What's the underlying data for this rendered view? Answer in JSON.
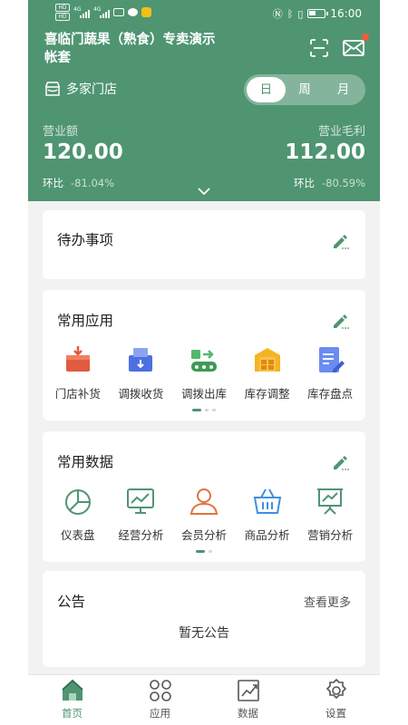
{
  "status_bar": {
    "time": "16:00",
    "left_indicators": [
      "HD",
      "HD",
      "4G",
      "4G"
    ],
    "icons": [
      "signal-icon",
      "signal-icon",
      "mail-icon",
      "chat-icon",
      "shield-icon",
      "nfc-icon",
      "bluetooth-icon",
      "vibrate-icon",
      "battery-icon"
    ]
  },
  "header": {
    "store_title": "喜临门蔬果（熟食）专卖演示帐套",
    "store_selector_label": "多家门店",
    "period_options": [
      "日",
      "周",
      "月"
    ],
    "active_period": "日",
    "revenue": {
      "label": "营业额",
      "value": "120.00",
      "change_label": "环比",
      "change_value": "-81.04%"
    },
    "gross_profit": {
      "label": "营业毛利",
      "value": "112.00",
      "change_label": "环比",
      "change_value": "-80.59%"
    }
  },
  "todo": {
    "title": "待办事项"
  },
  "common_apps": {
    "title": "常用应用",
    "items": [
      {
        "label": "门店补货",
        "icon": "store-replenish-icon"
      },
      {
        "label": "调拨收货",
        "icon": "transfer-receive-icon"
      },
      {
        "label": "调拨出库",
        "icon": "transfer-out-icon"
      },
      {
        "label": "库存调整",
        "icon": "inventory-adjust-icon"
      },
      {
        "label": "库存盘点",
        "icon": "inventory-count-icon"
      }
    ],
    "page_count": 3,
    "active_page": 1
  },
  "common_data": {
    "title": "常用数据",
    "items": [
      {
        "label": "仪表盘",
        "icon": "dashboard-icon"
      },
      {
        "label": "经营分析",
        "icon": "business-analysis-icon"
      },
      {
        "label": "会员分析",
        "icon": "member-analysis-icon"
      },
      {
        "label": "商品分析",
        "icon": "product-analysis-icon"
      },
      {
        "label": "营销分析",
        "icon": "marketing-analysis-icon"
      }
    ],
    "page_count": 2,
    "active_page": 1
  },
  "announcement": {
    "title": "公告",
    "more_label": "查看更多",
    "empty_text": "暂无公告"
  },
  "tab_bar": {
    "items": [
      {
        "label": "首页",
        "icon": "home-icon",
        "active": true
      },
      {
        "label": "应用",
        "icon": "apps-icon",
        "active": false
      },
      {
        "label": "数据",
        "icon": "data-icon",
        "active": false
      },
      {
        "label": "设置",
        "icon": "settings-icon",
        "active": false
      }
    ]
  },
  "colors": {
    "brand_green": "#4f9572",
    "background": "#f2f2f2",
    "notification_dot": "#f25a3c"
  }
}
